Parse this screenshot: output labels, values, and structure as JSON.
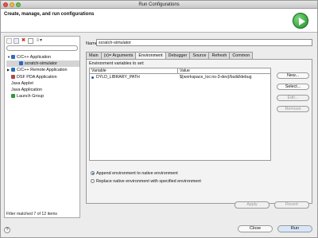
{
  "window": {
    "title": "Run Configurations"
  },
  "header": {
    "title": "Create, manage, and run configurations"
  },
  "left": {
    "toolbar": [
      "new-config",
      "duplicate",
      "delete",
      "collapse",
      "filter"
    ],
    "tree": [
      {
        "label": "C/C++ Application",
        "indent": 0,
        "twisty": "▼",
        "icon_color": "#2a6cc4"
      },
      {
        "label": "scratch-simulator",
        "indent": 1,
        "twisty": "",
        "icon_color": "#2a6cc4",
        "selected": true
      },
      {
        "label": "C/C++ Remote Application",
        "indent": 0,
        "twisty": "▶",
        "icon_color": "#2a6cc4"
      },
      {
        "label": "DSF PDA Application",
        "indent": 0,
        "twisty": "",
        "icon_color": "#b04848"
      },
      {
        "label": "Java Applet",
        "indent": 0,
        "twisty": "",
        "icon_color": ""
      },
      {
        "label": "Java Application",
        "indent": 0,
        "twisty": "",
        "icon_color": ""
      },
      {
        "label": "Launch Group",
        "indent": 0,
        "twisty": "",
        "icon_color": "#2c9a3a"
      }
    ],
    "filtered_text": "Filter matched 7 of 12 items"
  },
  "right": {
    "name_label": "Name:",
    "name_value": "scratch-simulator",
    "tabs": [
      {
        "label": "Main"
      },
      {
        "label": "(x)= Arguments"
      },
      {
        "label": "Environment",
        "active": true
      },
      {
        "label": "Debugger"
      },
      {
        "label": "Source"
      },
      {
        "label": "Refresh"
      },
      {
        "label": "Common"
      }
    ],
    "env_label": "Environment variables to set:",
    "table_headers": {
      "variable": "Variable",
      "value": "Value"
    },
    "rows": [
      {
        "variable": "DYLD_LIBRARY_PATH",
        "value": "${workspace_loc:ns-3-dev}/build/debug"
      }
    ],
    "side_buttons": {
      "new": "New...",
      "select": "Select...",
      "edit": "Edit...",
      "remove": "Remove"
    },
    "radios": {
      "append": "Append environment to native environment",
      "replace": "Replace native environment with specified environment"
    },
    "apply": "Apply",
    "revert": "Revert"
  },
  "footer": {
    "help": "?",
    "close": "Close",
    "run": "Run"
  }
}
